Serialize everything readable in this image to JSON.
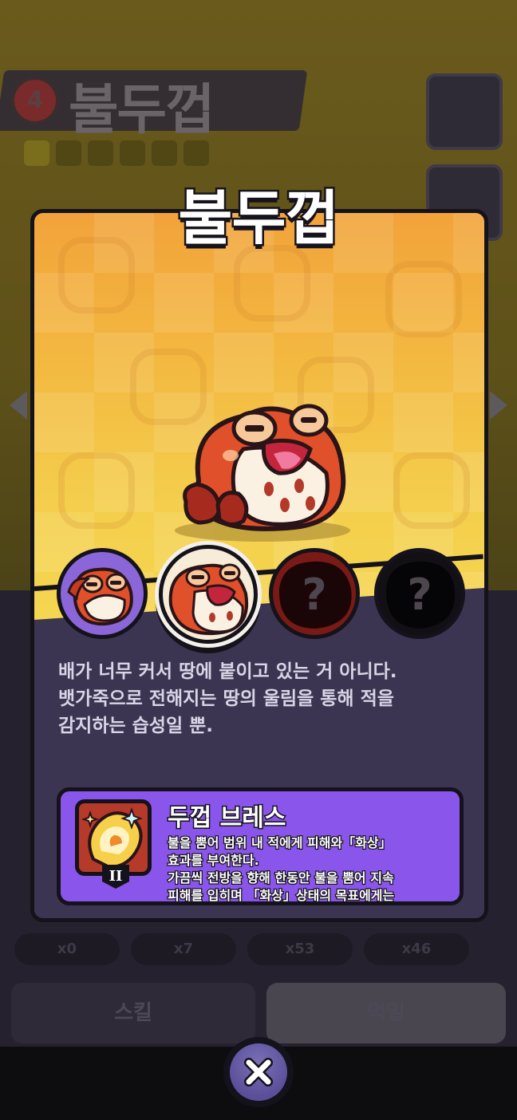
{
  "background": {
    "element_level": "4",
    "title": "불두껍",
    "stat_values": [
      "x0",
      "x7",
      "x53",
      "x46"
    ],
    "skill_button_label": "스킬",
    "feed_button_label": "먹일"
  },
  "popup": {
    "title": "불두껍",
    "evolution_slots": [
      {
        "state": "unlocked"
      },
      {
        "state": "selected"
      },
      {
        "state": "locked",
        "mark": "?"
      },
      {
        "state": "locked",
        "mark": "?"
      }
    ],
    "description": [
      "배가 너무 커서 땅에 붙이고 있는 거 아니다.",
      "뱃가죽으로 전해지는 땅의 울림을 통해 적을",
      "감지하는 습성일 뿐."
    ],
    "skill": {
      "name": "두껍 브레스",
      "level": "II",
      "description": [
        "불을 뿜어 범위 내 적에게 피해와「화상」",
        "효과를 부여한다.",
        "가끔씩 전방을 향해 한동안 불을 뿜어 지속",
        "피해를 입히며 「화상」상태의 목표에게는"
      ]
    },
    "close_icon": "close-icon"
  },
  "colors": {
    "art_background": "#f3b840",
    "panel": "#3c3552",
    "skill_card": "#8a55ea",
    "outline": "#14121a"
  }
}
